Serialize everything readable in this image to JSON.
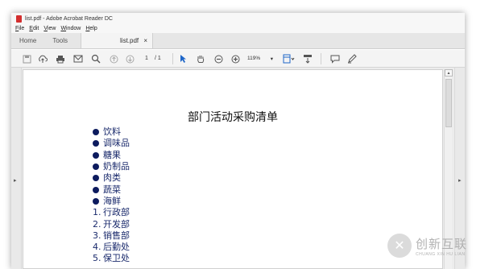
{
  "window": {
    "title": "list.pdf - Adobe Acrobat Reader DC"
  },
  "menu": [
    {
      "u": "F",
      "rest": "ile"
    },
    {
      "u": "E",
      "rest": "dit"
    },
    {
      "u": "V",
      "rest": "iew"
    },
    {
      "u": "W",
      "rest": "indow"
    },
    {
      "u": "H",
      "rest": "elp"
    }
  ],
  "tabs": {
    "home": "Home",
    "tools": "Tools",
    "doc": "list.pdf",
    "close": "×"
  },
  "toolbar": {
    "icons": [
      "save-icon",
      "upload-icon",
      "print-icon",
      "email-icon",
      "search-icon",
      "page-up-icon",
      "page-down-icon",
      "select-cursor-icon",
      "hand-tool-icon",
      "zoom-out-icon",
      "zoom-in-icon",
      "fit-page-icon",
      "scroll-mode-icon",
      "comment-icon",
      "pen-icon"
    ],
    "page_current": "1",
    "page_total": "/ 1",
    "zoom": "119%"
  },
  "document": {
    "title": "部门活动采购清单",
    "bullet_items": [
      "饮料",
      "调味品",
      "糖果",
      "奶制品",
      "肉类",
      "蔬菜",
      "海鲜"
    ],
    "numbered_items": [
      {
        "num": "1.",
        "text": "行政部"
      },
      {
        "num": "2.",
        "text": "开发部"
      },
      {
        "num": "3.",
        "text": "销售部"
      },
      {
        "num": "4.",
        "text": "后勤处"
      },
      {
        "num": "5.",
        "text": "保卫处"
      }
    ]
  },
  "watermark": {
    "main": "创新互联",
    "sub": "CHUANG XIN HU LIAN",
    "logo": "✕"
  },
  "colors": {
    "list_text": "#1a2a6c",
    "bullet": "#0d1b5e",
    "accent_blue": "#1e66c8"
  }
}
